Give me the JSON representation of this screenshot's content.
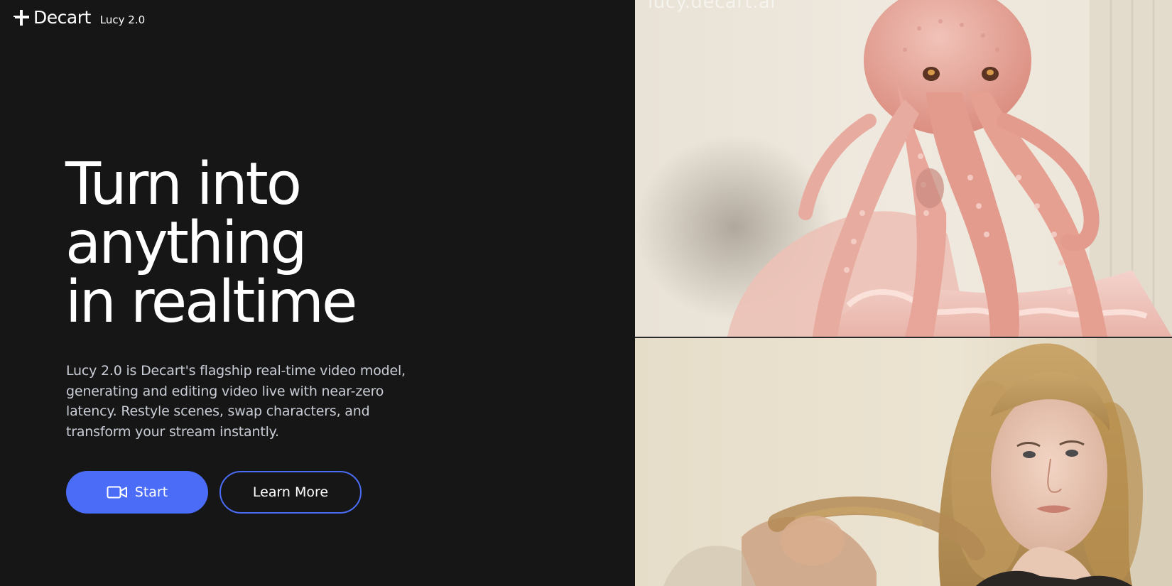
{
  "header": {
    "brand_name": "Decart",
    "product_version": "Lucy 2.0"
  },
  "hero": {
    "headline_lines": [
      "Turn into",
      "anything",
      "in realtime"
    ],
    "description": "Lucy 2.0 is Decart's flagship real-time video model, generating and editing video live with near-zero latency. Restyle scenes, swap characters, and transform your stream instantly."
  },
  "actions": {
    "start_label": "Start",
    "learn_more_label": "Learn More"
  },
  "preview": {
    "watermark": "lucy.decart.ai"
  },
  "colors": {
    "background": "#161616",
    "accent": "#4a6cf7",
    "text": "#ffffff",
    "muted_text": "#c9cdd6"
  },
  "icons": {
    "logo": "decart-cross-logo",
    "start": "video-camera-icon"
  }
}
